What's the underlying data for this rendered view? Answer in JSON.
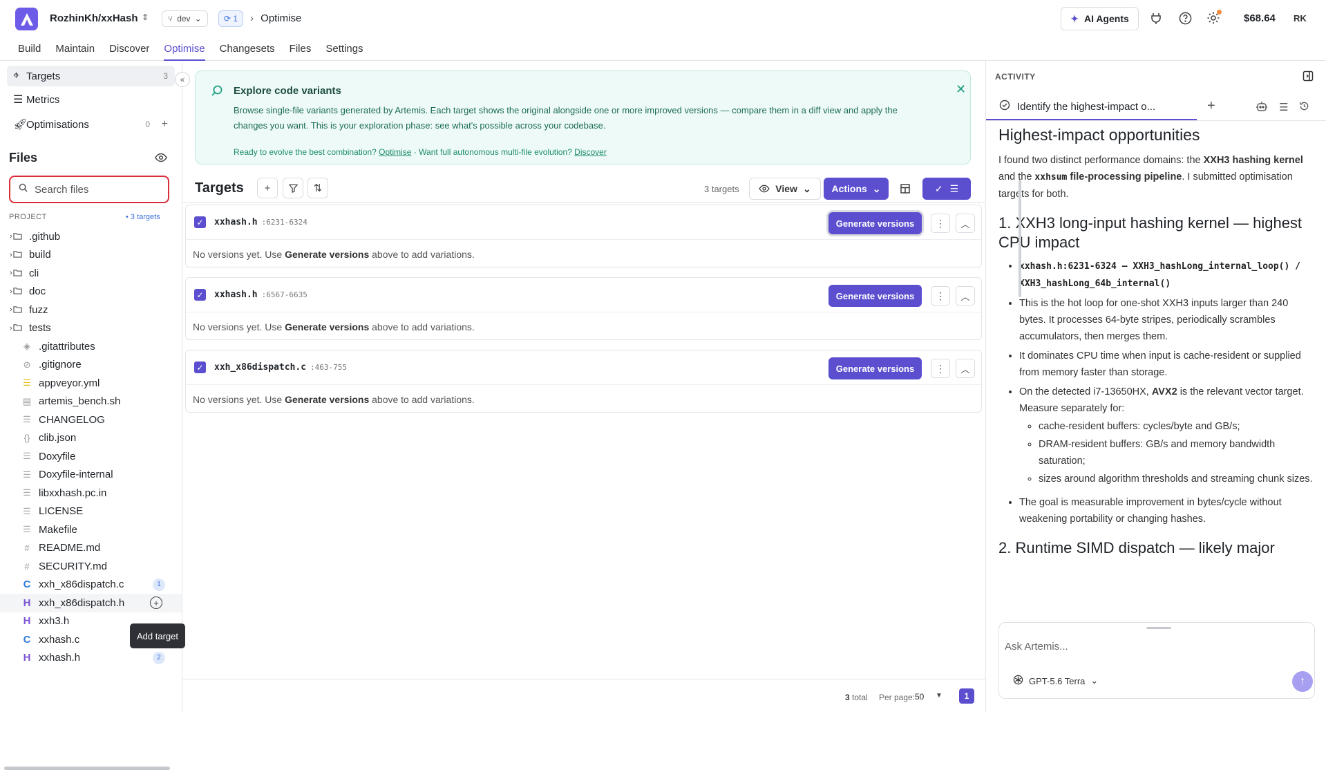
{
  "header": {
    "repo": "RozhinKh/xxHash",
    "branch": "dev",
    "sync_count": "1",
    "breadcrumb": "Optimise",
    "agents_label": "AI Agents",
    "balance": "$68.64",
    "user_initials": "RK"
  },
  "tabs": [
    {
      "label": "Build"
    },
    {
      "label": "Maintain"
    },
    {
      "label": "Discover"
    },
    {
      "label": "Optimise",
      "active": true
    },
    {
      "label": "Changesets"
    },
    {
      "label": "Files"
    },
    {
      "label": "Settings"
    }
  ],
  "sidebar": {
    "nav": [
      {
        "label": "Targets",
        "count": "3",
        "icon": "crosshair-icon"
      },
      {
        "label": "Metrics",
        "count": "",
        "icon": "bar-chart-icon"
      },
      {
        "label": "Optimisations",
        "count": "0",
        "icon": "rocket-icon"
      }
    ],
    "files_title": "Files",
    "search_placeholder": "Search files",
    "project_label": "PROJECT",
    "project_targets": "• 3 targets",
    "tree": [
      {
        "name": ".github",
        "type": "folder"
      },
      {
        "name": "build",
        "type": "folder"
      },
      {
        "name": "cli",
        "type": "folder"
      },
      {
        "name": "doc",
        "type": "folder"
      },
      {
        "name": "fuzz",
        "type": "folder"
      },
      {
        "name": "tests",
        "type": "folder"
      },
      {
        "name": ".gitattributes",
        "type": "file",
        "icon": "◈"
      },
      {
        "name": ".gitignore",
        "type": "file",
        "icon": "⊘"
      },
      {
        "name": "appveyor.yml",
        "type": "file",
        "icon": "☰"
      },
      {
        "name": "artemis_bench.sh",
        "type": "file",
        "icon": "▤"
      },
      {
        "name": "CHANGELOG",
        "type": "file",
        "icon": "☰"
      },
      {
        "name": "clib.json",
        "type": "file",
        "icon": "{}"
      },
      {
        "name": "Doxyfile",
        "type": "file",
        "icon": "☰"
      },
      {
        "name": "Doxyfile-internal",
        "type": "file",
        "icon": "☰"
      },
      {
        "name": "libxxhash.pc.in",
        "type": "file",
        "icon": "☰"
      },
      {
        "name": "LICENSE",
        "type": "file",
        "icon": "☰"
      },
      {
        "name": "Makefile",
        "type": "file",
        "icon": "☰"
      },
      {
        "name": "README.md",
        "type": "file",
        "icon": "#"
      },
      {
        "name": "SECURITY.md",
        "type": "file",
        "icon": "#"
      },
      {
        "name": "xxh_x86dispatch.c",
        "type": "file",
        "icon": "C",
        "badge": "1"
      },
      {
        "name": "xxh_x86dispatch.h",
        "type": "file",
        "icon": "H",
        "hover": true
      },
      {
        "name": "xxh3.h",
        "type": "file",
        "icon": "H"
      },
      {
        "name": "xxhash.c",
        "type": "file",
        "icon": "C"
      },
      {
        "name": "xxhash.h",
        "type": "file",
        "icon": "H",
        "badge": "2"
      }
    ],
    "tooltip": "Add target"
  },
  "banner": {
    "title": "Explore code variants",
    "description": "Browse single-file variants generated by Artemis. Each target shows the original alongside one or more improved versions — compare them in a diff view and apply the changes you want. This is your exploration phase: see what's possible across your codebase.",
    "footer_prefix": "Ready to evolve the best combination? ",
    "footer_link1": "Optimise",
    "footer_middle": " · Want full autonomous multi-file evolution? ",
    "footer_link2": "Discover"
  },
  "targets": {
    "title": "Targets",
    "count_label": "3 targets",
    "view_label": "View",
    "actions_label": "Actions",
    "items": [
      {
        "file": "xxhash.h",
        "range": ":6231-6324",
        "button": "Generate versions",
        "msg_pre": "No versions yet. Use ",
        "msg_bold": "Generate versions",
        "msg_post": " above to add variations."
      },
      {
        "file": "xxhash.h",
        "range": ":6567-6635",
        "button": "Generate versions",
        "msg_pre": "No versions yet. Use ",
        "msg_bold": "Generate versions",
        "msg_post": " above to add variations."
      },
      {
        "file": "xxh_x86dispatch.c",
        "range": ":463-755",
        "button": "Generate versions",
        "msg_pre": "No versions yet. Use ",
        "msg_bold": "Generate versions",
        "msg_post": " above to add variations."
      }
    ],
    "footer": {
      "total": "3",
      "total_suffix": "total",
      "per_page_label": "Per page:",
      "per_page": "50",
      "page": "1"
    }
  },
  "activity": {
    "title": "ACTIVITY",
    "tab_label": "Identify the highest-impact o...",
    "heading": "Highest-impact opportunities",
    "intro_1": "I found two distinct performance domains: the ",
    "intro_b1": "XXH3 hashing kernel",
    "intro_2": " and the ",
    "intro_code": "xxhsum",
    "intro_b2": " file-processing pipeline",
    "intro_3": ". I submitted optimisation targets for both.",
    "section1": "1. XXH3 long-input hashing kernel — highest CPU impact",
    "s1_code": "xxhash.h:6231-6324 — XXH3_hashLong_internal_loop() / XXH3_hashLong_64b_internal()",
    "s1_b1": "This is the hot loop for one-shot XXH3 inputs larger than 240 bytes. It processes 64-byte stripes, periodically scrambles accumulators, then merges them.",
    "s1_b2": "It dominates CPU time when input is cache-resident or supplied from memory faster than storage.",
    "s1_b3_pre": "On the detected i7-13650HX, ",
    "s1_b3_bold": "AVX2",
    "s1_b3_post": " is the relevant vector target. Measure separately for:",
    "s1_sub": [
      "cache-resident buffers: cycles/byte and GB/s;",
      "DRAM-resident buffers: GB/s and memory bandwidth saturation;",
      "sizes around algorithm thresholds and streaming chunk sizes."
    ],
    "s1_b4": "The goal is measurable improvement in bytes/cycle without weakening portability or changing hashes.",
    "section2": "2. Runtime SIMD dispatch — likely major",
    "chat_placeholder": "Ask Artemis...",
    "model": "GPT-5.6 Terra"
  }
}
